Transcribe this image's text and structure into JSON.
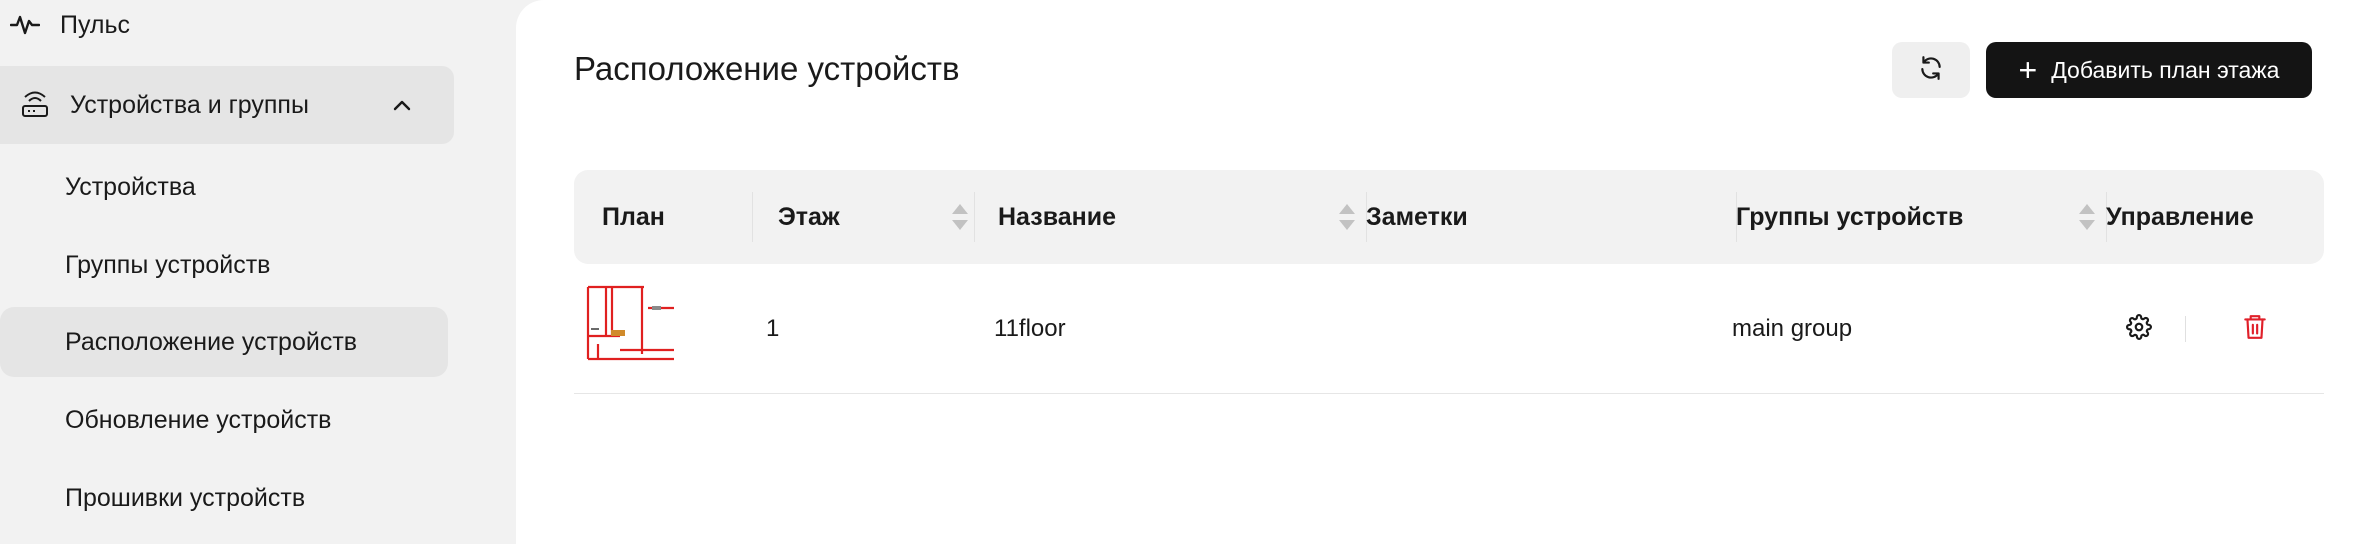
{
  "sidebar": {
    "pulse_label": "Пульс",
    "group_label": "Устройства и группы",
    "items": [
      {
        "label": "Устройства"
      },
      {
        "label": "Группы устройств"
      },
      {
        "label": "Расположение устройств"
      },
      {
        "label": "Обновление устройств"
      },
      {
        "label": "Прошивки устройств"
      }
    ]
  },
  "page": {
    "title": "Расположение устройств",
    "add_button_label": "Добавить план этажа"
  },
  "table": {
    "columns": [
      "План",
      "Этаж",
      "Название",
      "Заметки",
      "Группы устройств",
      "Управление"
    ],
    "rows": [
      {
        "floor": "1",
        "name": "11floor",
        "notes": "",
        "groups": "main group"
      }
    ]
  },
  "colors": {
    "accent_dark": "#141414",
    "delete_red": "#e0202a",
    "plan_red": "#e02020"
  },
  "icons": [
    "pulse-icon",
    "router-icon",
    "chevron-up-icon",
    "refresh-icon",
    "plus-icon",
    "sort-icon",
    "gear-icon",
    "trash-icon"
  ]
}
